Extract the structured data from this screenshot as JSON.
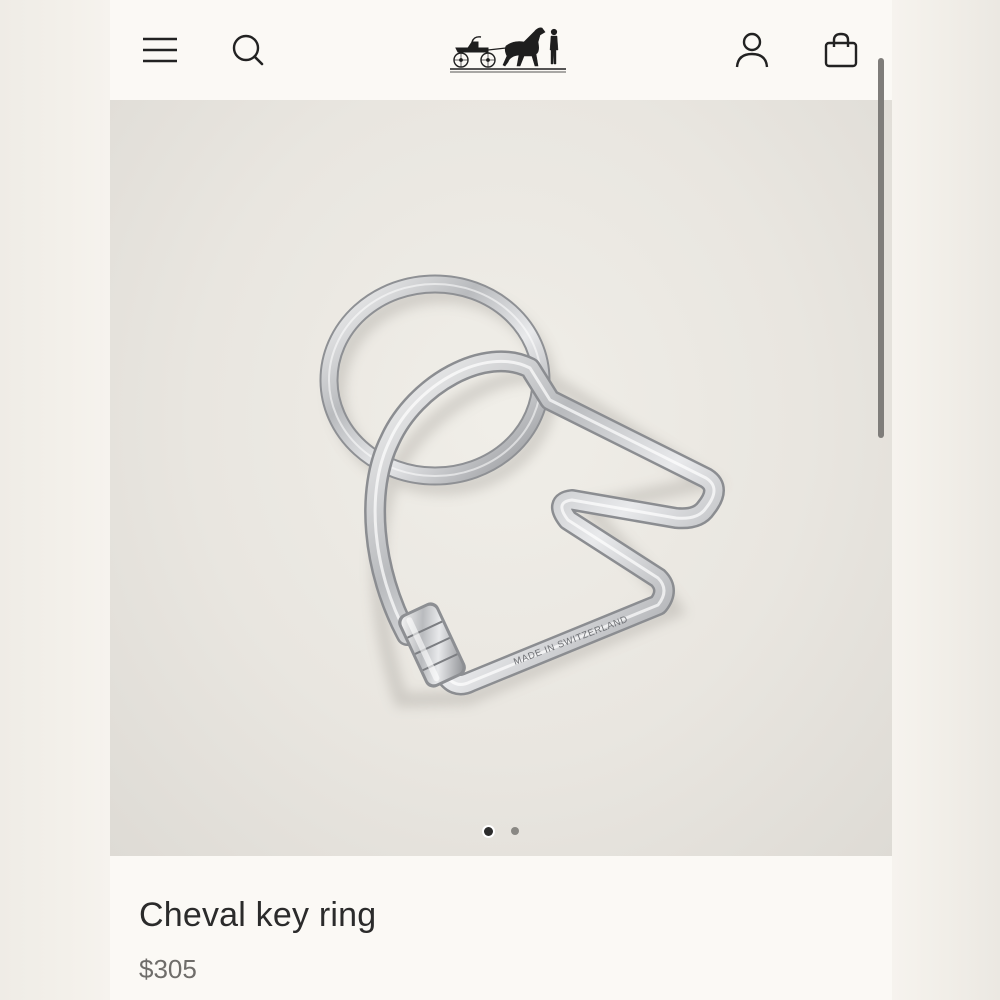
{
  "header": {
    "menu_icon": "hamburger-menu-icon",
    "search_icon": "search-icon",
    "logo": "horse-carriage-logo",
    "account_icon": "user-account-icon",
    "bag_icon": "shopping-bag-icon"
  },
  "gallery": {
    "image_alt": "Cheval key ring",
    "engraving": "MADE IN SWITZERLAND",
    "slides": 2,
    "active_slide": 1
  },
  "product": {
    "name": "Cheval key ring",
    "price": "$305"
  },
  "colors": {
    "page_background": "#fbf9f5",
    "text_primary": "#2b2b2b",
    "text_secondary": "#6f6d6a"
  }
}
